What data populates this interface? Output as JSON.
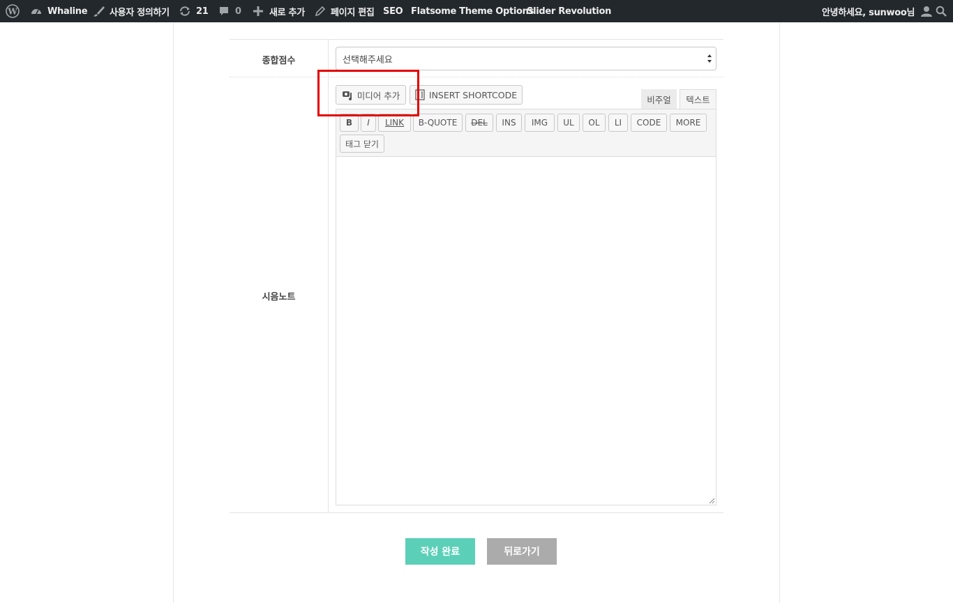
{
  "adminbar": {
    "site_name": "Whaline",
    "customize_label": "사용자 정의하기",
    "updates_count": "21",
    "comments_count": "0",
    "new_label": "새로 추가",
    "edit_page_label": "페이지 편집",
    "seo_label": "SEO",
    "flatsome_label": "Flatsome Theme Options",
    "slider_label": "Slider Revolution",
    "greeting": "안녕하세요, sunwoo님"
  },
  "form": {
    "score_label": "종합점수",
    "score_select_value": "선택해주세요",
    "note_label": "시음노트",
    "note_value": ""
  },
  "editor": {
    "add_media_label": "미디어 추가",
    "insert_shortcode_label": "INSERT SHORTCODE",
    "tab_visual": "비주얼",
    "tab_text": "텍스트",
    "quicktags": [
      "B",
      "I",
      "LINK",
      "B-QUOTE",
      "DEL",
      "INS",
      "IMG",
      "UL",
      "OL",
      "LI",
      "CODE",
      "MORE",
      "태그 닫기"
    ]
  },
  "actions": {
    "submit_label": "작성 완료",
    "back_label": "뒤로가기"
  },
  "colors": {
    "adminbar_bg": "#23282d",
    "submit_bg": "#5ccfb8",
    "back_bg": "#ababab",
    "highlight": "#e20000"
  }
}
